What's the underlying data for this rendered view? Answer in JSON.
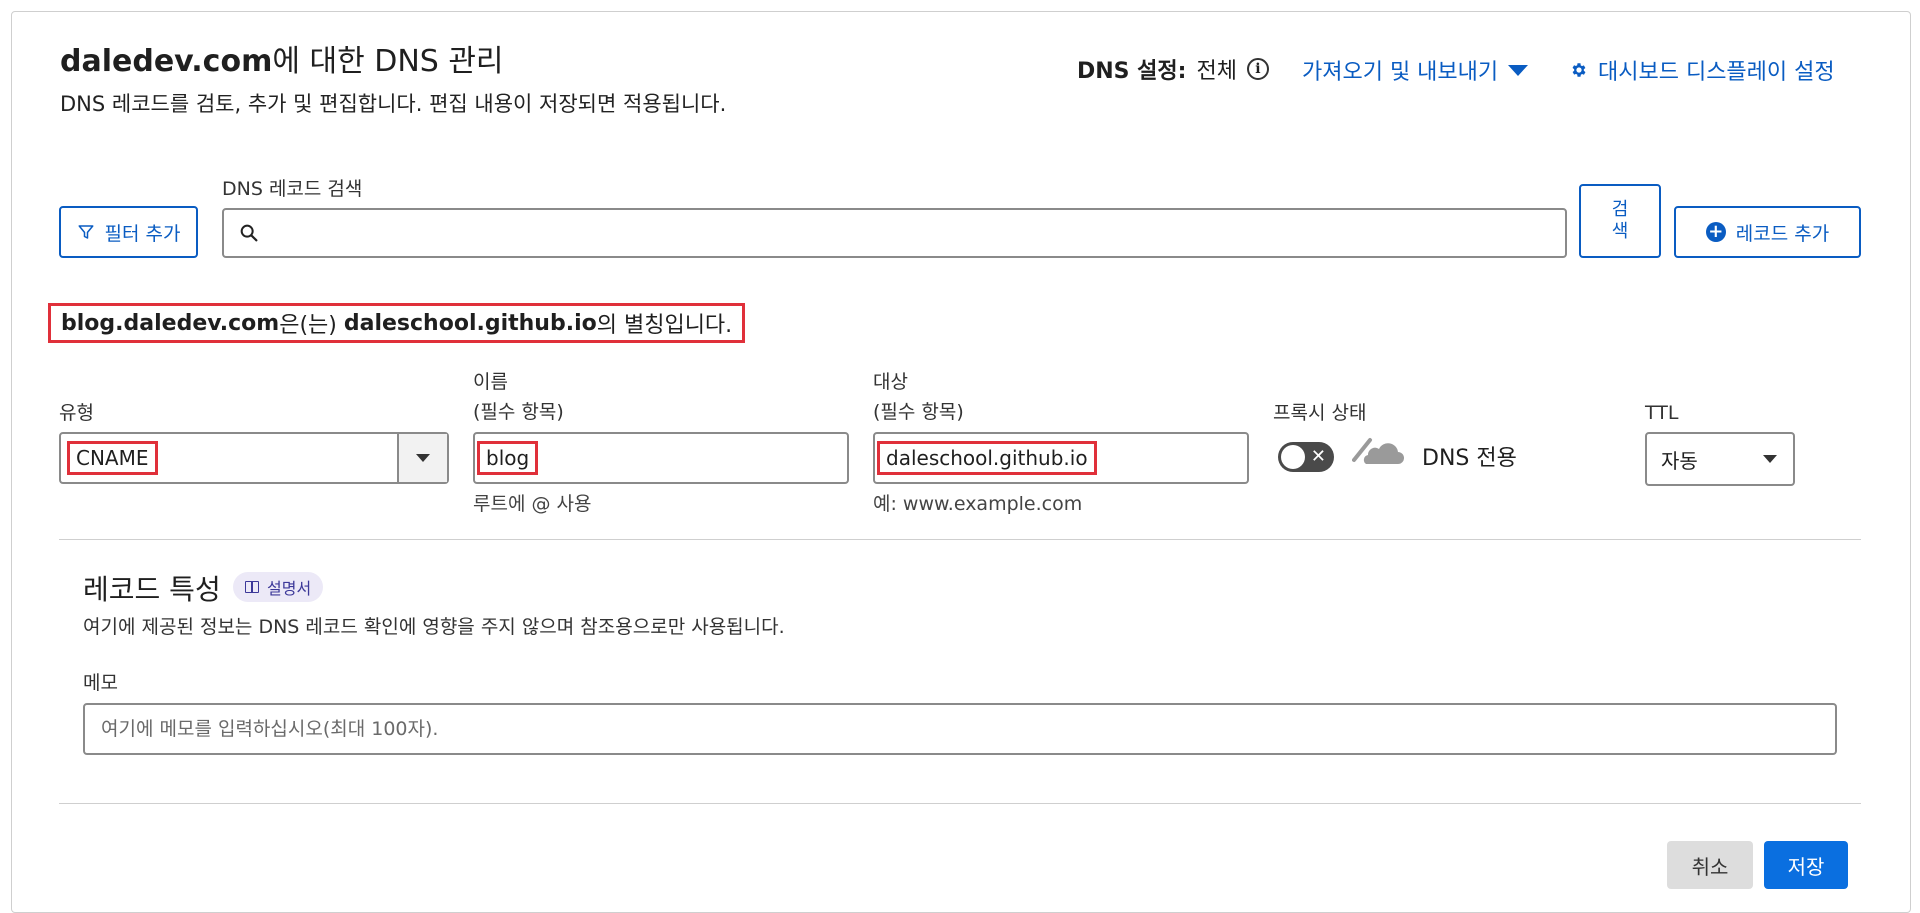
{
  "header": {
    "title_domain": "daledev.com",
    "title_suffix": "에 대한 DNS 관리",
    "subtitle": "DNS 레코드를 검토, 추가 및 편집합니다. 편집 내용이 저장되면 적용됩니다.",
    "dns_setting_label": "DNS 설정:",
    "dns_setting_value": "전체",
    "info_symbol": "i",
    "import_export_label": "가져오기 및 내보내기",
    "dashboard_settings_label": "대시보드 디스플레이 설정"
  },
  "toolbar": {
    "filter_label": "필터 추가",
    "search_label": "DNS 레코드 검색",
    "search_value": "",
    "search_button_line1": "검",
    "search_button_line2": "색",
    "add_record_label": "레코드 추가",
    "add_record_symbol": "+"
  },
  "alias": {
    "source": "blog.daledev.com",
    "connector": "은(는) ",
    "target": "daleschool.github.io",
    "suffix": "의 별칭입니다."
  },
  "form": {
    "type_label": "유형",
    "type_value": "CNAME",
    "name_label_line1": "이름",
    "name_label_line2": "(필수 항목)",
    "name_value": "blog",
    "name_helper": "루트에 @ 사용",
    "target_label_line1": "대상",
    "target_label_line2": "(필수 항목)",
    "target_value": "daleschool.github.io",
    "target_helper": "예: www.example.com",
    "proxy_label": "프록시 상태",
    "proxy_toggle_symbol": "✕",
    "proxy_text": "DNS 전용",
    "proxy_enabled": false,
    "ttl_label": "TTL",
    "ttl_value": "자동"
  },
  "attributes": {
    "title": "레코드 특성",
    "doc_label": "설명서",
    "description": "여기에 제공된 정보는 DNS 레코드 확인에 영향을 주지 않으며 참조용으로만 사용됩니다.",
    "memo_label": "메모",
    "memo_placeholder": "여기에 메모를 입력하십시오(최대 100자).",
    "memo_value": ""
  },
  "actions": {
    "cancel_label": "취소",
    "save_label": "저장"
  },
  "colors": {
    "accent": "#0a5cc2",
    "save_button": "#0a6fe0",
    "highlight": "#e0303a",
    "cancel_button": "#dddddd"
  }
}
